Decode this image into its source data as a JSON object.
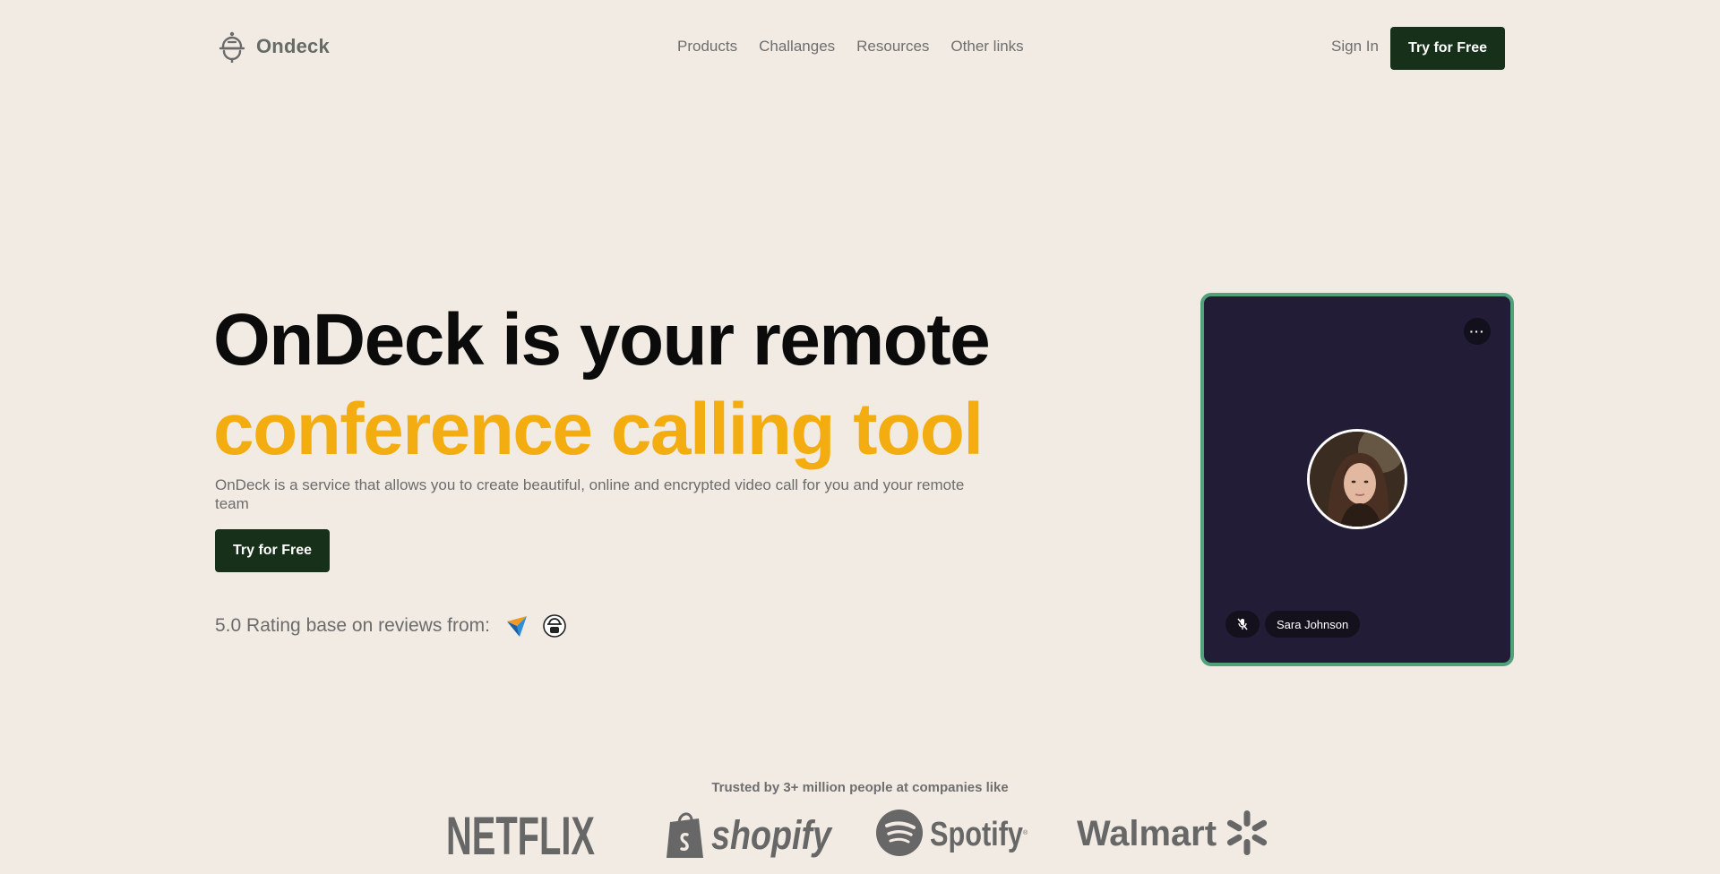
{
  "brand": {
    "name": "Ondeck"
  },
  "nav": {
    "links": [
      "Products",
      "Challanges",
      "Resources",
      "Other links"
    ],
    "sign_in": "Sign In",
    "cta": "Try for Free"
  },
  "hero": {
    "title_line1": "OnDeck is your remote",
    "title_line2": "conference calling tool",
    "subtitle": "OnDeck is a service that allows you to create beautiful, online and encrypted video call for you and your remote team",
    "cta": "Try for Free",
    "rating_text": "5.0 Rating base on reviews from:"
  },
  "video_call": {
    "more_label": "···",
    "participant_name": "Sara Johnson"
  },
  "trusted": {
    "text": "Trusted by 3+ million people at companies like",
    "logos": [
      "NETFLIX",
      "shopify",
      "Spotify",
      "Walmart"
    ]
  },
  "colors": {
    "background": "#f2ebe3",
    "primary": "#16301a",
    "accent": "#f3ad10",
    "card": "#221c36",
    "card_border": "#4fa27a"
  }
}
